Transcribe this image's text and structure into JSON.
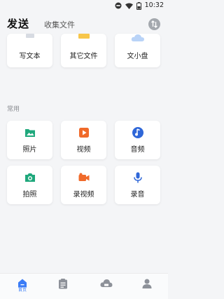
{
  "status_bar": {
    "time": "10:32"
  },
  "header": {
    "title": "发送",
    "tab": "收集文件"
  },
  "top_cards": [
    {
      "label": "写文本",
      "icon": "text-icon"
    },
    {
      "label": "其它文件",
      "icon": "folder-icon"
    },
    {
      "label": "文小盘",
      "icon": "cloud-icon"
    }
  ],
  "common": {
    "title": "常用",
    "items": [
      {
        "label": "照片",
        "icon": "photo-icon"
      },
      {
        "label": "视频",
        "icon": "video-icon"
      },
      {
        "label": "音频",
        "icon": "music-icon"
      },
      {
        "label": "拍照",
        "icon": "camera-icon"
      },
      {
        "label": "录视频",
        "icon": "video-record-icon"
      },
      {
        "label": "录音",
        "icon": "microphone-icon"
      }
    ]
  },
  "bottom_nav": {
    "items": [
      {
        "label": "首页",
        "icon": "home-icon",
        "active": true
      },
      {
        "icon": "clipboard-icon",
        "active": false
      },
      {
        "icon": "cloud-drive-icon",
        "active": false
      },
      {
        "icon": "person-icon",
        "active": false
      }
    ]
  },
  "colors": {
    "accent": "#3b7cf6",
    "photo": "#1fa87c",
    "video": "#f06a2a",
    "music": "#2f67d8"
  }
}
